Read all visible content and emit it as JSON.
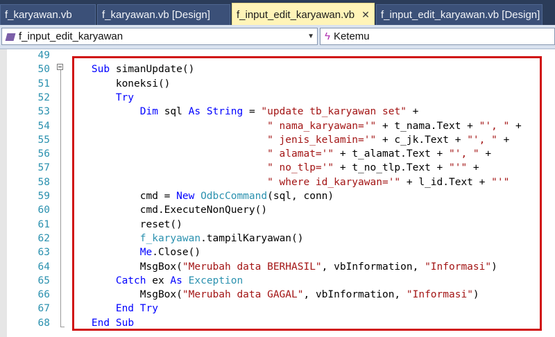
{
  "tabs": [
    {
      "label": "f_karyawan.vb",
      "active": false
    },
    {
      "label": "f_karyawan.vb [Design]",
      "active": false
    },
    {
      "label": "f_input_edit_karyawan.vb",
      "active": true
    },
    {
      "label": "f_input_edit_karyawan.vb [Design]",
      "active": false
    }
  ],
  "navbar": {
    "class_selector": "f_input_edit_karyawan",
    "member_selector": "Ketemu",
    "class_icon": "class-icon",
    "member_icon": "event-lightning-icon"
  },
  "colors": {
    "tab_strip": "#2b3c59",
    "active_tab": "#fff4b8",
    "keyword": "#0000ff",
    "string": "#a31515",
    "type": "#2b91af",
    "highlight_frame": "#d01010"
  },
  "code_lines": [
    {
      "num": "49",
      "segments": []
    },
    {
      "num": "50",
      "segments": [
        {
          "t": "    "
        },
        {
          "t": "Sub",
          "c": "kw"
        },
        {
          "t": " simanUpdate()"
        }
      ]
    },
    {
      "num": "51",
      "segments": [
        {
          "t": "        koneksi()"
        }
      ]
    },
    {
      "num": "52",
      "segments": [
        {
          "t": "        "
        },
        {
          "t": "Try",
          "c": "kw"
        }
      ]
    },
    {
      "num": "53",
      "segments": [
        {
          "t": "            "
        },
        {
          "t": "Dim",
          "c": "kw"
        },
        {
          "t": " sql "
        },
        {
          "t": "As",
          "c": "kw"
        },
        {
          "t": " "
        },
        {
          "t": "String",
          "c": "kw"
        },
        {
          "t": " = "
        },
        {
          "t": "\"update tb_karyawan set\"",
          "c": "str"
        },
        {
          "t": " +"
        }
      ]
    },
    {
      "num": "54",
      "segments": [
        {
          "t": "                                 "
        },
        {
          "t": "\" nama_karyawan='\"",
          "c": "str"
        },
        {
          "t": " + t_nama.Text + "
        },
        {
          "t": "\"', \"",
          "c": "str"
        },
        {
          "t": " +"
        }
      ]
    },
    {
      "num": "55",
      "segments": [
        {
          "t": "                                 "
        },
        {
          "t": "\" jenis_kelamin='\"",
          "c": "str"
        },
        {
          "t": " + c_jk.Text + "
        },
        {
          "t": "\"', \"",
          "c": "str"
        },
        {
          "t": " +"
        }
      ]
    },
    {
      "num": "56",
      "segments": [
        {
          "t": "                                 "
        },
        {
          "t": "\" alamat='\"",
          "c": "str"
        },
        {
          "t": " + t_alamat.Text + "
        },
        {
          "t": "\"', \"",
          "c": "str"
        },
        {
          "t": " +"
        }
      ]
    },
    {
      "num": "57",
      "segments": [
        {
          "t": "                                 "
        },
        {
          "t": "\" no_tlp='\"",
          "c": "str"
        },
        {
          "t": " + t_no_tlp.Text + "
        },
        {
          "t": "\"'\"",
          "c": "str"
        },
        {
          "t": " +"
        }
      ]
    },
    {
      "num": "58",
      "segments": [
        {
          "t": "                                 "
        },
        {
          "t": "\" where id_karyawan='\"",
          "c": "str"
        },
        {
          "t": " + l_id.Text + "
        },
        {
          "t": "\"'\"",
          "c": "str"
        }
      ]
    },
    {
      "num": "59",
      "segments": [
        {
          "t": "            cmd = "
        },
        {
          "t": "New",
          "c": "kw"
        },
        {
          "t": " "
        },
        {
          "t": "OdbcCommand",
          "c": "typ"
        },
        {
          "t": "(sql, conn)"
        }
      ]
    },
    {
      "num": "60",
      "segments": [
        {
          "t": "            cmd.ExecuteNonQuery()"
        }
      ]
    },
    {
      "num": "61",
      "segments": [
        {
          "t": "            reset()"
        }
      ]
    },
    {
      "num": "62",
      "segments": [
        {
          "t": "            "
        },
        {
          "t": "f_karyawan",
          "c": "typ"
        },
        {
          "t": ".tampilKaryawan()"
        }
      ]
    },
    {
      "num": "63",
      "segments": [
        {
          "t": "            "
        },
        {
          "t": "Me",
          "c": "kw"
        },
        {
          "t": ".Close()"
        }
      ]
    },
    {
      "num": "64",
      "segments": [
        {
          "t": "            MsgBox("
        },
        {
          "t": "\"Merubah data BERHASIL\"",
          "c": "str"
        },
        {
          "t": ", vbInformation, "
        },
        {
          "t": "\"Informasi\"",
          "c": "str"
        },
        {
          "t": ")"
        }
      ]
    },
    {
      "num": "65",
      "segments": [
        {
          "t": "        "
        },
        {
          "t": "Catch",
          "c": "kw"
        },
        {
          "t": " ex "
        },
        {
          "t": "As",
          "c": "kw"
        },
        {
          "t": " "
        },
        {
          "t": "Exception",
          "c": "typ"
        }
      ]
    },
    {
      "num": "66",
      "segments": [
        {
          "t": "            MsgBox("
        },
        {
          "t": "\"Merubah data GAGAL\"",
          "c": "str"
        },
        {
          "t": ", vbInformation, "
        },
        {
          "t": "\"Informasi\"",
          "c": "str"
        },
        {
          "t": ")"
        }
      ]
    },
    {
      "num": "67",
      "segments": [
        {
          "t": "        "
        },
        {
          "t": "End",
          "c": "kw"
        },
        {
          "t": " "
        },
        {
          "t": "Try",
          "c": "kw"
        }
      ]
    },
    {
      "num": "68",
      "segments": [
        {
          "t": "    "
        },
        {
          "t": "End",
          "c": "kw"
        },
        {
          "t": " "
        },
        {
          "t": "Sub",
          "c": "kw"
        }
      ]
    }
  ]
}
